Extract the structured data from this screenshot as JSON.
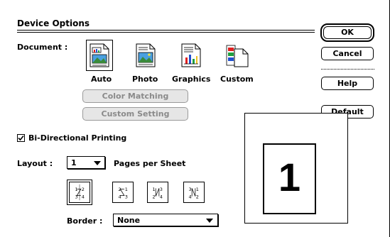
{
  "dialog": {
    "group_title": "Device Options",
    "document_label": "Document :",
    "doc_types": [
      {
        "label": "Auto",
        "icon": "auto-document-icon",
        "selected": true
      },
      {
        "label": "Photo",
        "icon": "photo-document-icon",
        "selected": false
      },
      {
        "label": "Graphics",
        "icon": "graphics-document-icon",
        "selected": false
      },
      {
        "label": "Custom",
        "icon": "custom-document-icon",
        "selected": false
      }
    ],
    "color_matching_label": "Color Matching",
    "custom_setting_label": "Custom Setting",
    "bidirectional": {
      "label": "Bi-Directional Printing",
      "checked": true
    },
    "layout": {
      "label": "Layout :",
      "pages_value": "1",
      "pages_suffix": "Pages per Sheet",
      "orders": [
        "1 2 / 3 4",
        "2 1 / 4 3",
        "1 3 / 2 4",
        "3 1 / 4 2"
      ],
      "selected_order": 0
    },
    "border": {
      "label": "Border :",
      "value": "None"
    },
    "preview": {
      "page_number": "1"
    }
  },
  "buttons": {
    "ok": "OK",
    "cancel": "Cancel",
    "help": "Help",
    "default": "Default"
  }
}
